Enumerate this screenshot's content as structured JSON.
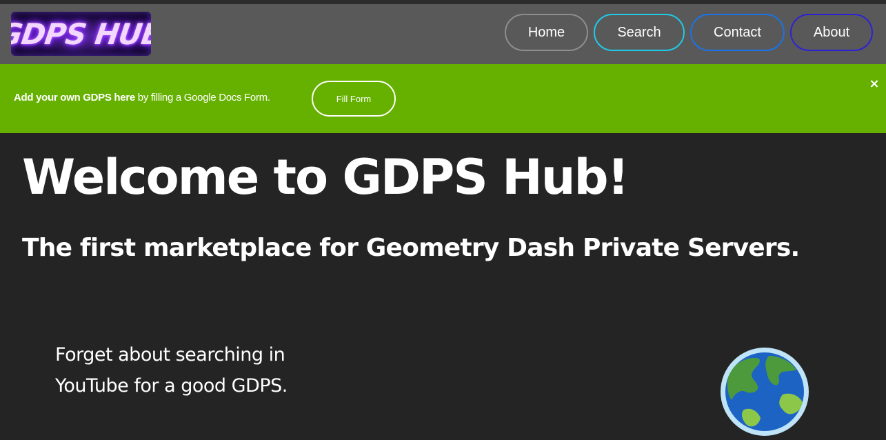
{
  "header": {
    "logo_text": "GDPS HUB",
    "nav": {
      "home": "Home",
      "search": "Search",
      "contact": "Contact",
      "about": "About"
    }
  },
  "banner": {
    "bold_text": "Add your own GDPS here",
    "rest_text": " by filling a Google Docs Form.",
    "button_label": "Fill Form",
    "close_label": "×"
  },
  "hero": {
    "title": "Welcome to GDPS Hub!",
    "subtitle": "The first marketplace for Geometry Dash Private Servers."
  },
  "feature": {
    "text": "Forget about searching in YouTube for a good GDPS.",
    "icon": "globe-icon"
  },
  "colors": {
    "navbar": "#595959",
    "banner": "#66b100",
    "background": "#242424",
    "home_border": "#8e8e8e",
    "search_border": "#1ecbe8",
    "contact_border": "#1a73e8",
    "about_border": "#2b22d6"
  }
}
